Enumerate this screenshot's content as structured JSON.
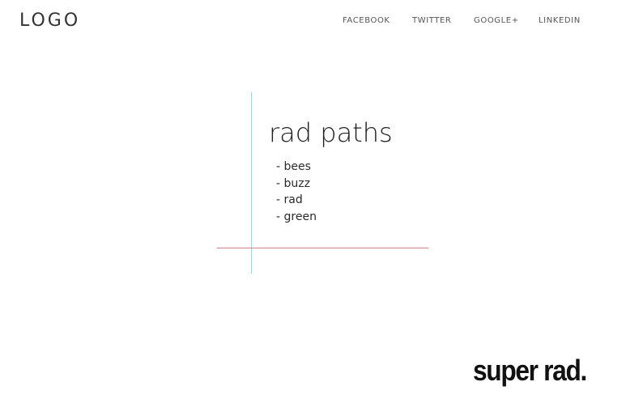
{
  "header": {
    "logo_text": "LOGO",
    "nav": [
      {
        "label": "FACEBOOK"
      },
      {
        "label": "TWITTER"
      },
      {
        "label": "GOOGLE+"
      },
      {
        "label": "LINKEDIN"
      }
    ]
  },
  "main": {
    "title": "rad paths",
    "items": [
      {
        "label": "- bees"
      },
      {
        "label": "- buzz"
      },
      {
        "label": "- rad"
      },
      {
        "label": "- green"
      }
    ],
    "accent_colors": {
      "vertical_line": "#7fe3ea",
      "horizontal_line": "#d9818f"
    }
  },
  "footer": {
    "tagline": "super rad."
  }
}
